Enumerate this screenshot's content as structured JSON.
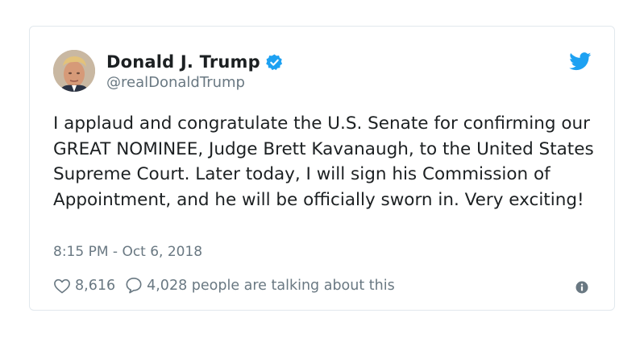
{
  "tweet": {
    "author_name": "Donald J. Trump",
    "handle": "@realDonaldTrump",
    "text": "I applaud and congratulate the U.S. Senate for confirming our GREAT NOMINEE, Judge Brett Kavanaugh, to the United States Supreme Court. Later today, I will sign his Commission of Appointment, and he will be officially sworn in. Very exciting!",
    "timestamp": "8:15 PM - Oct 6, 2018",
    "likes": "8,616",
    "replies_text": "4,028 people are talking about this"
  },
  "icons": {
    "verified": "verified-badge-icon",
    "bird": "twitter-bird-icon",
    "like": "heart-icon",
    "reply": "speech-bubble-icon",
    "info": "info-icon"
  },
  "colors": {
    "brand": "#1da1f2",
    "text": "#1c2022",
    "muted": "#697882",
    "border": "#e1e8ed"
  }
}
